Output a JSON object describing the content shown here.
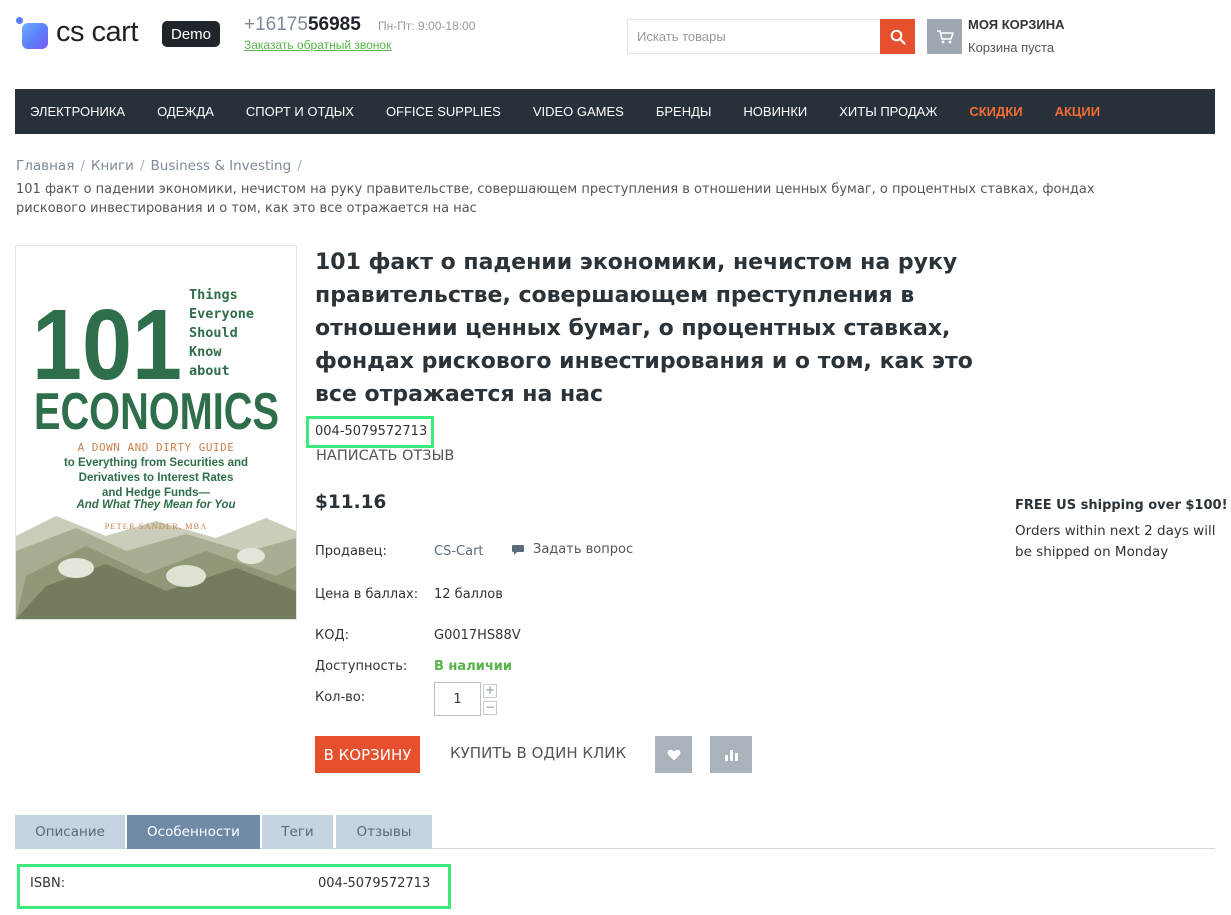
{
  "header": {
    "logo_text": "cs cart",
    "demo_badge": "Demo",
    "phone_prefix": "+16175",
    "phone_bold": "56985",
    "hours": "Пн-Пт: 9:00-18:00",
    "callback_link": "Заказать обратный звонок",
    "search_placeholder": "Искать товары",
    "cart_title": "МОЯ КОРЗИНА",
    "cart_status": "Корзина пуста"
  },
  "nav": {
    "items": [
      "ЭЛЕКТРОНИКА",
      "ОДЕЖДА",
      "СПОРТ И ОТДЫХ",
      "OFFICE SUPPLIES",
      "VIDEO GAMES",
      "БРЕНДЫ",
      "НОВИНКИ",
      "ХИТЫ ПРОДАЖ",
      "СКИДКИ",
      "АКЦИИ"
    ],
    "accent_color": "#f26d33"
  },
  "breadcrumb": {
    "items": [
      "Главная",
      "Книги",
      "Business & Investing"
    ],
    "separator": "/",
    "current": "101 факт о падении экономики, нечистом на руку правительстве, совершающем преступления в отношении ценных бумаг, о процентных ставках, фондах рискового инвестирования и о том, как это все отражается на нас"
  },
  "book_cover": {
    "number": "101",
    "side_words": [
      "Things",
      "Everyone",
      "Should",
      "Know",
      "about"
    ],
    "title_word": "ECONOMICS",
    "subtitle_line1": "A DOWN AND DIRTY GUIDE",
    "subtitle_lines": [
      "to Everything from Securities and",
      "Derivatives to Interest Rates",
      "and Hedge Funds—"
    ],
    "subtitle_italic": "And What They Mean for You",
    "author": "PETER SANDER, MBA"
  },
  "product": {
    "title": "101 факт о падении экономики, нечистом на руку правительстве, совершающем преступления в отношении ценных бумаг, о процентных ставках, фондах рискового инвестирования и о том, как это все отражается на нас",
    "sku_top": "004-5079572713",
    "review_link": "НАПИСАТЬ ОТЗЫВ",
    "price": "$11.16",
    "seller_label": "Продавец:",
    "seller_value": "CS-Cart",
    "ask_question": "Задать вопрос",
    "points_label": "Цена в баллах:",
    "points_value": "12 баллов",
    "code_label": "КОД:",
    "code_value": "G0017HS88V",
    "availability_label": "Доступность:",
    "availability_value": "В наличии",
    "qty_label": "Кол-во:",
    "qty_value": "1",
    "qty_plus": "+",
    "qty_minus": "−",
    "add_to_cart": "В КОРЗИНУ",
    "buy_one_click": "КУПИТЬ В ОДИН КЛИК",
    "wishlist_icon": "heart-icon",
    "compare_icon": "bar-chart-icon"
  },
  "shipping": {
    "title": "FREE US shipping over $100!",
    "text": "Orders within next 2 days will be shipped on Monday"
  },
  "tabs": {
    "items": [
      "Описание",
      "Особенности",
      "Теги",
      "Отзывы"
    ],
    "active": "Особенности"
  },
  "features": {
    "isbn_label": "ISBN:",
    "isbn_value": "004-5079572713"
  },
  "colors": {
    "primary_button": "#e6502e",
    "nav_bg": "#283039",
    "in_stock": "#58b44a",
    "highlight_box": "#3deb7c",
    "active_tab": "#6f8aa7"
  }
}
